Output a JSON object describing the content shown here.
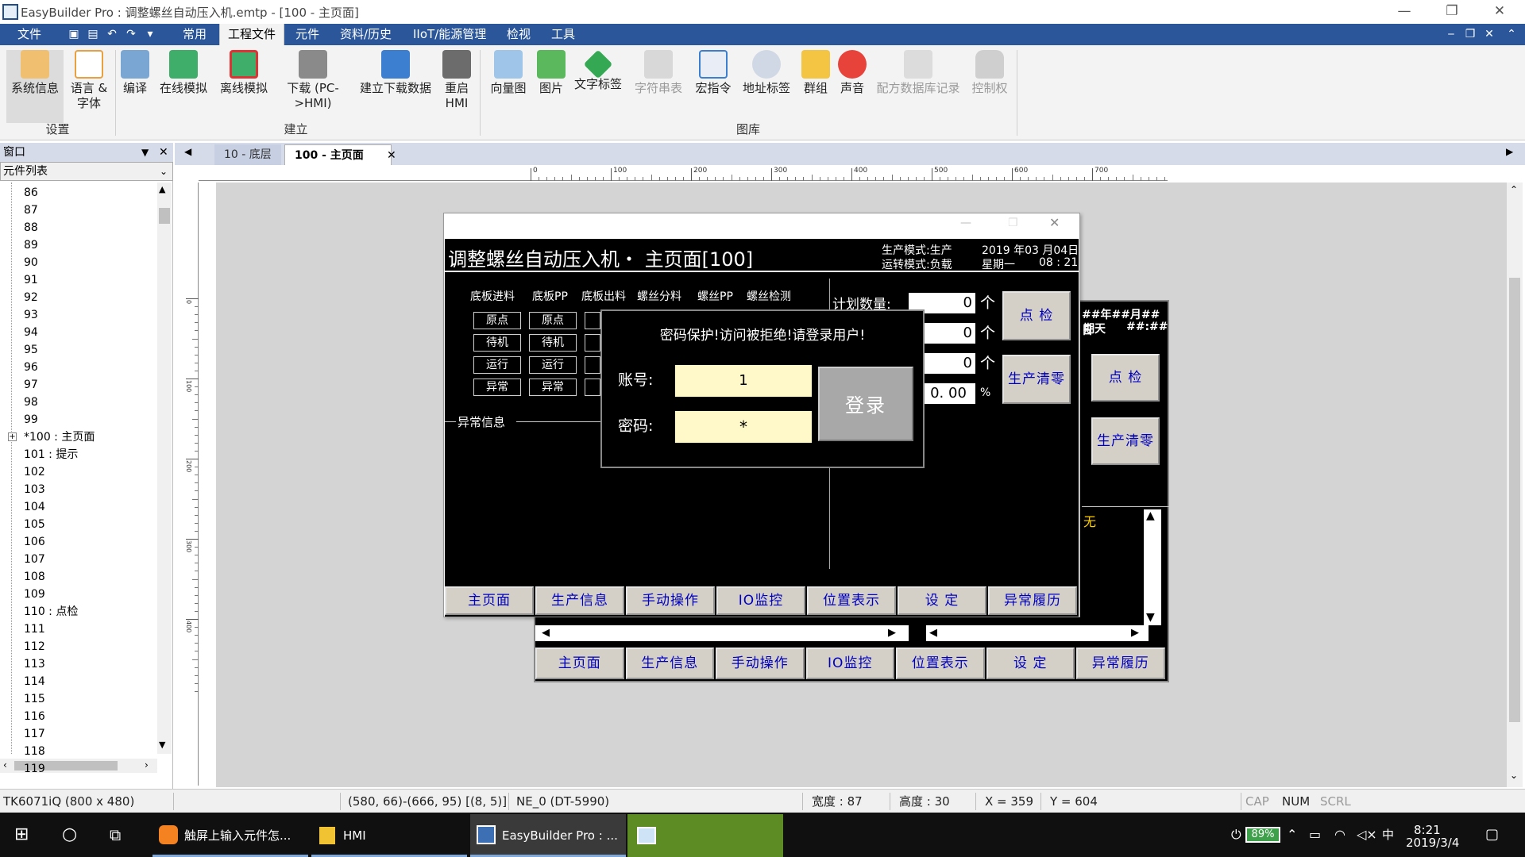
{
  "window": {
    "title": "EasyBuilder Pro : 调整螺丝自动压入机.emtp - [100 - 主页面]",
    "controls": [
      "—",
      "❐",
      "✕"
    ]
  },
  "menu": {
    "items": [
      "文件",
      "常用",
      "工程文件",
      "元件",
      "资料/历史",
      "IIoT/能源管理",
      "检视",
      "工具"
    ],
    "active": "工程文件"
  },
  "ribbon": {
    "groups": [
      {
        "label": "设置",
        "buttons": [
          "系统信息",
          "语言 & 字体"
        ]
      },
      {
        "label": "建立",
        "buttons": [
          "编译",
          "在线模拟",
          "离线模拟",
          "下载 (PC->HMI)",
          "建立下载数据",
          "重启 HMI"
        ]
      },
      {
        "label": "图库",
        "buttons": [
          "向量图",
          "图片",
          "文字标签",
          "字符串表",
          "宏指令",
          "地址标签",
          "群组",
          "声音",
          "配方数据库记录",
          "控制权"
        ]
      }
    ]
  },
  "left_panel": {
    "header": "窗口",
    "combo": "元件列表",
    "items": [
      "86",
      "87",
      "88",
      "89",
      "90",
      "91",
      "92",
      "93",
      "94",
      "95",
      "96",
      "97",
      "98",
      "99",
      "*100 : 主页面",
      "101 : 提示",
      "102",
      "103",
      "104",
      "105",
      "106",
      "107",
      "108",
      "109",
      "110 : 点检",
      "111",
      "112",
      "113",
      "114",
      "115",
      "116",
      "117",
      "118",
      "119"
    ]
  },
  "doc_tabs": [
    {
      "label": "10 - 底层",
      "active": false
    },
    {
      "label": "100 - 主页面",
      "active": true
    }
  ],
  "ruler_marks": [
    "0",
    "100",
    "200",
    "300",
    "400",
    "500",
    "600",
    "700"
  ],
  "ruler_v_marks": [
    "0",
    "100",
    "200",
    "300",
    "400"
  ],
  "hmi_main": {
    "title": "调整螺丝自动压入机・ 主页面[100]",
    "prod_mode": "生产模式:生产",
    "run_mode": "运转模式:负载",
    "date": "2019 年03 月04日",
    "weekday": "星期一",
    "time": "08 : 21",
    "columns": [
      "底板进料",
      "底板PP",
      "底板出料",
      "螺丝分料",
      "螺丝PP",
      "螺丝检测"
    ],
    "row_labels": [
      "原点",
      "待机",
      "运行",
      "异常"
    ],
    "plan_label": "计划数量:",
    "plan_value": "0",
    "unit": "个",
    "count2": "0",
    "count3": "0",
    "rate": "0. 00",
    "percent": "%",
    "check_btn": "点 检",
    "clear_btn": "生产清零",
    "abnormal_label": "异常信息",
    "nav": [
      "主页面",
      "生产信息",
      "手动操作",
      "IO监控",
      "位置表示",
      "设 定",
      "异常履历"
    ]
  },
  "hmi_base": {
    "date_line": "##年##月##日",
    "week_line": "期天",
    "time_line": "##:##",
    "check_btn": "点 检",
    "clear_btn": "生产清零",
    "list_first": "无",
    "nav": [
      "主页面",
      "生产信息",
      "手动操作",
      "IO监控",
      "位置表示",
      "设 定",
      "异常履历"
    ]
  },
  "login_dialog": {
    "message": "密码保护!访问被拒绝!请登录用户!",
    "account_label": "账号:",
    "account_value": "1",
    "password_label": "密码:",
    "password_value": "*",
    "login_button": "登录"
  },
  "status_bar": {
    "model": "TK6071iQ (800 x 480)",
    "coords": "(580, 66)-(666, 95) [(8, 5)]",
    "object": "NE_0 (DT-5990)",
    "width": "宽度 : 87",
    "height": "高度 : 30",
    "x": "X = 359",
    "y": "Y = 604",
    "cap": "CAP",
    "num": "NUM",
    "scrl": "SCRL"
  },
  "taskbar": {
    "apps": [
      "触屏上输入元件怎...",
      "HMI",
      "EasyBuilder Pro : ..."
    ],
    "battery": "89%",
    "ime": "中",
    "time": "8:21",
    "date": "2019/3/4"
  }
}
